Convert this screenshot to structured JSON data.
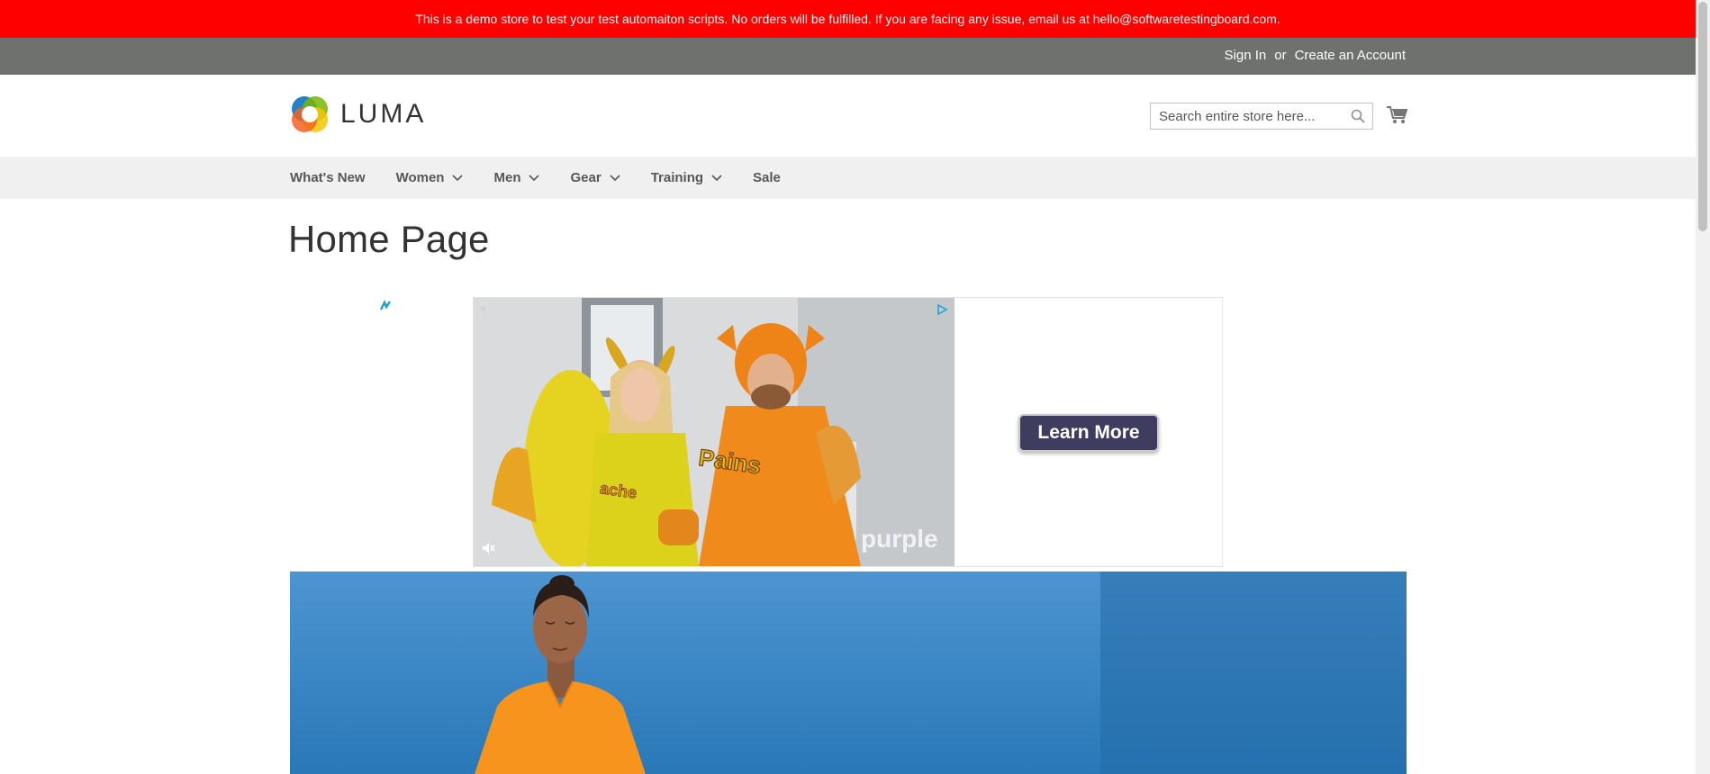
{
  "notice": {
    "text": "This is a demo store to test your test automaiton scripts. No orders will be fulfilled. If you are facing any issue, email us at hello@softwaretestingboard.com."
  },
  "top_panel": {
    "sign_in": "Sign In",
    "or": "or",
    "create_account": "Create an Account"
  },
  "header": {
    "logo_text": "LUMA",
    "search_placeholder": "Search entire store here...",
    "colors": {
      "logo_blue": "#1979c3",
      "logo_orange": "#f26322",
      "logo_yellow": "#f7c600",
      "logo_green": "#77b800"
    }
  },
  "nav": {
    "items": [
      {
        "label": "What's New",
        "has_dropdown": false
      },
      {
        "label": "Women",
        "has_dropdown": true
      },
      {
        "label": "Men",
        "has_dropdown": true
      },
      {
        "label": "Gear",
        "has_dropdown": true
      },
      {
        "label": "Training",
        "has_dropdown": true
      },
      {
        "label": "Sale",
        "has_dropdown": false
      }
    ]
  },
  "main": {
    "page_title": "Home Page"
  },
  "ad": {
    "brand_watermark": "purple",
    "cta_label": "Learn More",
    "close_glyph": "×"
  },
  "colors": {
    "notice_bg": "#ff0000",
    "top_panel_bg": "#6e716e",
    "nav_bg": "#f0f0f0",
    "cta_bg": "#3f3d5f",
    "hero_sky": "#2f7fc0",
    "shirt_orange": "#f7941d"
  }
}
